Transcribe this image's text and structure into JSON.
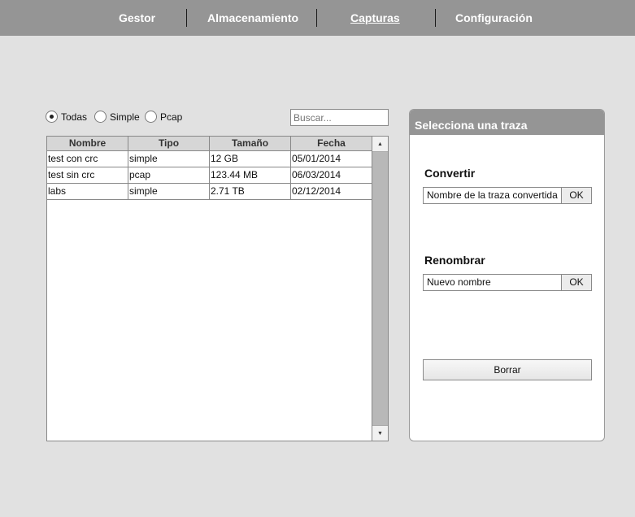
{
  "nav": {
    "items": [
      {
        "label": "Gestor"
      },
      {
        "label": "Almacenamiento"
      },
      {
        "label": "Capturas",
        "active": true
      },
      {
        "label": "Configuración"
      }
    ]
  },
  "filter": {
    "options": [
      {
        "label": "Todas",
        "checked": true
      },
      {
        "label": "Simple",
        "checked": false
      },
      {
        "label": "Pcap",
        "checked": false
      }
    ],
    "search_placeholder": "Buscar..."
  },
  "table": {
    "columns": [
      "Nombre",
      "Tipo",
      "Tamaño",
      "Fecha"
    ],
    "rows": [
      [
        "test con crc",
        "simple",
        "12 GB",
        "05/01/2014"
      ],
      [
        "test sin crc",
        "pcap",
        "123.44 MB",
        "06/03/2014"
      ],
      [
        "labs",
        "simple",
        "2.71 TB",
        "02/12/2014"
      ]
    ]
  },
  "panel": {
    "title": "Selecciona una traza",
    "convert": {
      "title": "Convertir",
      "field_value": "Nombre de la traza convertida",
      "ok_label": "OK"
    },
    "rename": {
      "title": "Renombrar",
      "field_value": "Nuevo nombre",
      "ok_label": "OK"
    },
    "delete_label": "Borrar"
  },
  "colors": {
    "nav_bg": "#959595",
    "page_bg": "#e1e1e1",
    "panel_header_bg": "#959595"
  },
  "icons": {
    "scroll_up": "▲",
    "scroll_down": "▼"
  }
}
